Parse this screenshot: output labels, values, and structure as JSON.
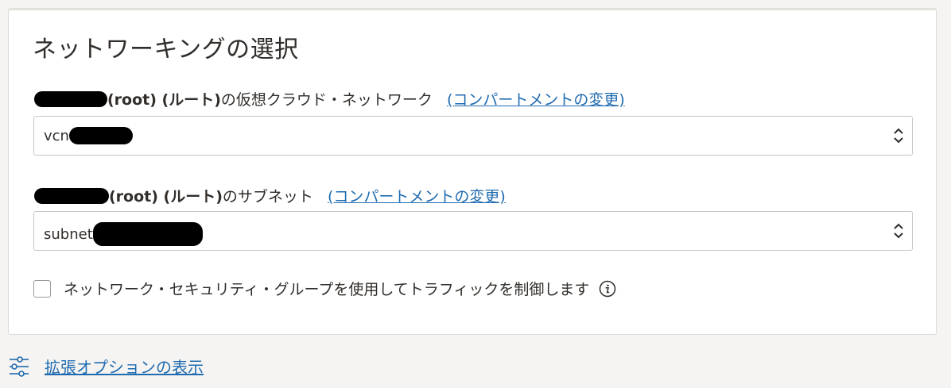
{
  "section": {
    "title": "ネットワーキングの選択"
  },
  "vcn": {
    "label_root": "(root) (ルート)",
    "label_suffix": "の仮想クラウド・ネットワーク",
    "change_compartment": "(コンパートメントの変更)",
    "value_prefix": "vcn"
  },
  "subnet": {
    "label_root": "(root) (ルート)",
    "label_suffix": "のサブネット",
    "change_compartment": "(コンパートメントの変更)",
    "value_prefix": "subnet"
  },
  "nsg": {
    "label": "ネットワーク・セキュリティ・グループを使用してトラフィックを制御します",
    "checked": false
  },
  "advanced": {
    "label": "拡張オプションの表示"
  },
  "colors": {
    "link": "#1f6bb0",
    "text": "#312d2a",
    "background": "#f5f4f2"
  }
}
